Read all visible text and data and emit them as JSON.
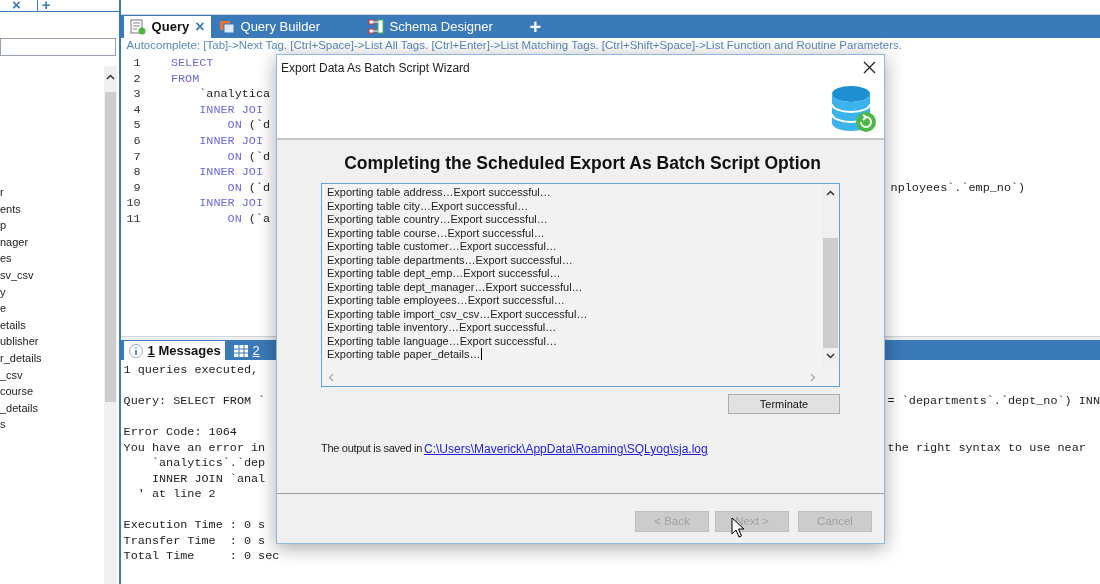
{
  "top_strip": {
    "close": "×",
    "add": "+"
  },
  "sidebar": {
    "items": [
      {
        "label": "r"
      },
      {
        "label": "ents"
      },
      {
        "label": "p"
      },
      {
        "label": "nager"
      },
      {
        "label": "es"
      },
      {
        "label": "sv_csv"
      },
      {
        "label": "y"
      },
      {
        "label": "e"
      },
      {
        "label": "etails"
      },
      {
        "label": "ublisher"
      },
      {
        "label": "r_details"
      },
      {
        "label": "_csv"
      },
      {
        "label": "course"
      },
      {
        "label": "_details"
      },
      {
        "label": "s"
      }
    ]
  },
  "editor_tabs": [
    {
      "label": "Query",
      "selected": true,
      "kind": "query",
      "close": "×"
    },
    {
      "label": "Query Builder",
      "selected": false,
      "kind": "builder"
    },
    {
      "label": "Schema Designer",
      "selected": false,
      "kind": "designer"
    }
  ],
  "editor_add_tab": "+",
  "editor": {
    "autocomplete": "Autocomplete: [Tab]->Next Tag. [Ctrl+Space]->List All Tags. [Ctrl+Enter]->List Matching Tags. [Ctrl+Shift+Space]->List Function and Routine Parameters.",
    "lines": [
      {
        "number": "1",
        "segments": [
          {
            "text": "    SELECT",
            "kind": "keyword"
          }
        ]
      },
      {
        "number": "2",
        "segments": [
          {
            "text": "    FROM",
            "kind": "keyword"
          }
        ]
      },
      {
        "number": "3",
        "segments": [
          {
            "text": "        `analytica",
            "kind": "plain"
          }
        ]
      },
      {
        "number": "4",
        "segments": [
          {
            "text": "        INNER JOI",
            "kind": "keyword"
          }
        ]
      },
      {
        "number": "5",
        "segments": [
          {
            "text": "            ON",
            "kind": "keyword"
          },
          {
            "text": " (`d",
            "kind": "plain"
          }
        ]
      },
      {
        "number": "6",
        "segments": [
          {
            "text": "        INNER JOI",
            "kind": "keyword"
          }
        ]
      },
      {
        "number": "7",
        "segments": [
          {
            "text": "            ON",
            "kind": "keyword"
          },
          {
            "text": " (`d",
            "kind": "plain"
          }
        ]
      },
      {
        "number": "8",
        "segments": [
          {
            "text": "        INNER JOI",
            "kind": "keyword"
          }
        ]
      },
      {
        "number": "9",
        "segments": [
          {
            "text": "            ON",
            "kind": "keyword"
          },
          {
            "text": " (`d",
            "kind": "plain"
          }
        ],
        "right": "nployees`.`emp_no`)"
      },
      {
        "number": "10",
        "segments": [
          {
            "text": "        INNER JOI",
            "kind": "keyword"
          }
        ]
      },
      {
        "number": "11",
        "segments": [
          {
            "text": "            ON",
            "kind": "keyword"
          },
          {
            "text": " (`a",
            "kind": "plain"
          }
        ]
      }
    ]
  },
  "result_tabs": [
    {
      "number": "1",
      "label": "Messages",
      "selected": true,
      "kind": "info"
    },
    {
      "number": "2",
      "selected": false,
      "kind": "grid"
    }
  ],
  "messages": [
    [
      {
        "text": "1 queries executed,"
      }
    ],
    [
      {
        "text": "Query: SELECT FROM `",
        "right": "= `departments`.`dept_no`) INN"
      }
    ],
    [
      {
        "text": "Error Code: 1064"
      },
      {
        "text": "You have an error in",
        "right": "the right syntax to use near"
      },
      {
        "text": "    `analytics`.`dep"
      },
      {
        "text": "    INNER JOIN `anal"
      },
      {
        "text": "  ' at line 2"
      }
    ],
    [
      {
        "text": "Execution Time : 0 s"
      },
      {
        "text": "Transfer Time  : 0 s"
      },
      {
        "text": "Total Time     : 0 sec"
      }
    ]
  ],
  "dialog": {
    "title": "Export Data As Batch Script Wizard",
    "heading": "Completing the Scheduled Export As Batch Script Option",
    "log": [
      "Exporting table address…Export successful…",
      "Exporting table city…Export successful…",
      "Exporting table country…Export successful…",
      "Exporting table course…Export successful…",
      "Exporting table customer…Export successful…",
      "Exporting table departments…Export successful…",
      "Exporting table dept_emp…Export successful…",
      "Exporting table dept_manager…Export successful…",
      "Exporting table employees…Export successful…",
      "Exporting table import_csv_csv…Export successful…",
      "Exporting table inventory…Export successful…",
      "Exporting table language…Export successful…",
      "Exporting table paper_details…"
    ],
    "terminate": "Terminate",
    "output_text": "The output is saved in",
    "output_link": "C:\\Users\\Maverick\\AppData\\Roaming\\SQLyog\\sja.log",
    "buttons": [
      {
        "label": "< Back",
        "disabled": true
      },
      {
        "label": "Next >",
        "disabled": true
      },
      {
        "label": "Cancel",
        "disabled": true
      }
    ]
  }
}
